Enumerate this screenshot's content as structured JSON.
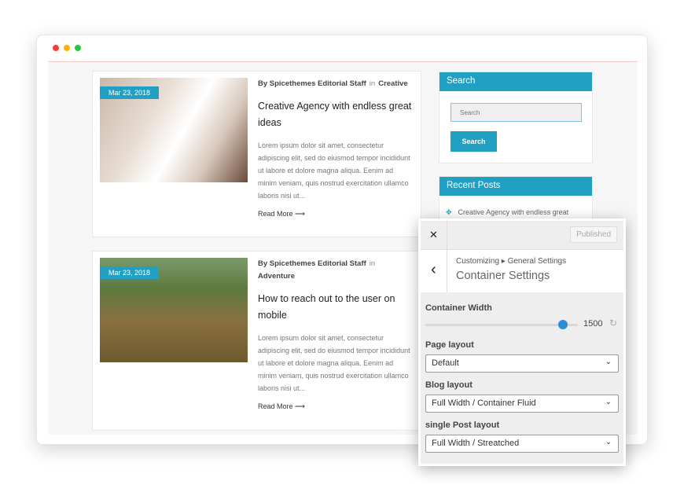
{
  "window": {
    "dots": [
      "#ff3b30",
      "#ffb000",
      "#27c93f"
    ]
  },
  "posts": [
    {
      "date": "Mar 23, 2018",
      "by": "By Spicethemes Editorial Staff",
      "in": "in",
      "category": "Creative",
      "title": "Creative Agency with endless great ideas",
      "excerpt": "Lorem ipsum dolor sit amet, consectetur adipiscing elit, sed do eiusmod tempor incididunt ut labore et dolore magna aliqua. Eenim ad minim veniam, quis nostrud exercitation ullamco laboris nisi ut...",
      "read_more": "Read More ⟶"
    },
    {
      "date": "Mar 23, 2018",
      "by": "By Spicethemes Editorial Staff",
      "in": "in",
      "category": "Adventure",
      "title": "How to reach out to the user on mobile",
      "excerpt": "Lorem ipsum dolor sit amet, consectetur adipiscing elit, sed do eiusmod tempor incididunt ut labore et dolore magna aliqua. Eenim ad minim veniam, quis nostrud exercitation ullamco laboris nisi ut...",
      "read_more": "Read More ⟶"
    }
  ],
  "sidebar": {
    "search_title": "Search",
    "search_placeholder": "Search",
    "search_button": "Search",
    "recent_title": "Recent Posts",
    "recent_items": [
      "Creative Agency with endless great"
    ]
  },
  "customizer": {
    "close": "✕",
    "published": "Published",
    "back": "‹",
    "breadcrumb": "Customizing ▸ General Settings",
    "title": "Container Settings",
    "container_width_label": "Container Width",
    "container_width_value": "1500",
    "slider_fraction": 0.9,
    "page_layout_label": "Page layout",
    "page_layout": "Default",
    "blog_layout_label": "Blog layout",
    "blog_layout": "Full Width / Container Fluid",
    "single_layout_label": "single Post layout",
    "single_layout": "Full Width / Streatched"
  }
}
